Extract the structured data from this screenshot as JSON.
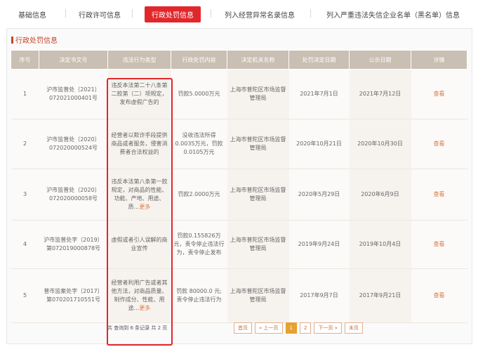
{
  "tabs": {
    "basic": "基础信息",
    "license": "行政许可信息",
    "penalty": "行政处罚信息",
    "abnormal": "列入经营异常名录信息",
    "blacklist": "列入严重违法失信企业名单（黑名单）信息"
  },
  "section": {
    "title": "行政处罚信息"
  },
  "table": {
    "headers": [
      "序号",
      "决定书文号",
      "违法行为类型",
      "行政处罚内容",
      "决定机关名称",
      "处罚决定日期",
      "公示日期",
      "详情"
    ],
    "rows": [
      {
        "no": "1",
        "doc": "沪市监普处〔2021〕072021000401号",
        "violation": "违反本法第二十八条第二款第（二）项规定，发布虚假广告的",
        "violation_more": "",
        "penalty": "罚款5.0000万元",
        "authority": "上海市普陀区市场监督管理局",
        "decision_date": "2021年7月1日",
        "publish_date": "2021年7月12日",
        "detail": "查看"
      },
      {
        "no": "2",
        "doc": "沪市监普处〔2020〕072020000524号",
        "violation": "经营者以欺诈手段提供商品或者服务，侵害消费者合法权益的",
        "violation_more": "",
        "penalty": "没收违法所得0.0035万元，罚款0.0105万元",
        "authority": "上海市普陀区市场监督管理局",
        "decision_date": "2020年10月21日",
        "publish_date": "2020年10月30日",
        "detail": "查看"
      },
      {
        "no": "3",
        "doc": "沪市监普处〔2020〕072020000058号",
        "violation": "违反本法第八条第一款规定，对商品的性能、功能、产地、用途、质...",
        "violation_more": "更多",
        "penalty": "罚款2.0000万元",
        "authority": "上海市普陀区市场监督管理局",
        "decision_date": "2020年5月29日",
        "publish_date": "2020年6月9日",
        "detail": "查看"
      },
      {
        "no": "4",
        "doc": "沪市监普处字（2019）第072019000878号",
        "violation": "虚假或者引人误解的商业宣传",
        "violation_more": "",
        "penalty": "罚款0.155826万元，责令停止违法行为，责令停止发布",
        "authority": "上海市普陀区市场监督管理局",
        "decision_date": "2019年9月24日",
        "publish_date": "2019年10月4日",
        "detail": "查看"
      },
      {
        "no": "5",
        "doc": "普市监案处字〔2017〕第070201710551号",
        "violation": "经营者利用广告或者其他方法，对商品质量、制作成分、性能、用途...",
        "violation_more": "更多",
        "penalty": "罚款 80000.0 元;责令停止违法行为",
        "authority": "上海市普陀区市场监督管理局",
        "decision_date": "2017年9月7日",
        "publish_date": "2017年9月21日",
        "detail": "查看"
      }
    ]
  },
  "pagination": {
    "summary": "共 查询到 6 条记录 共 2 页",
    "first": "首页",
    "prev": "« 上一页",
    "page1": "1",
    "page2": "2",
    "next": "下一页 »",
    "last": "末页"
  },
  "colors": {
    "accent": "#e2272c",
    "header_bg": "#c9bfb2",
    "link": "#e0763a"
  }
}
